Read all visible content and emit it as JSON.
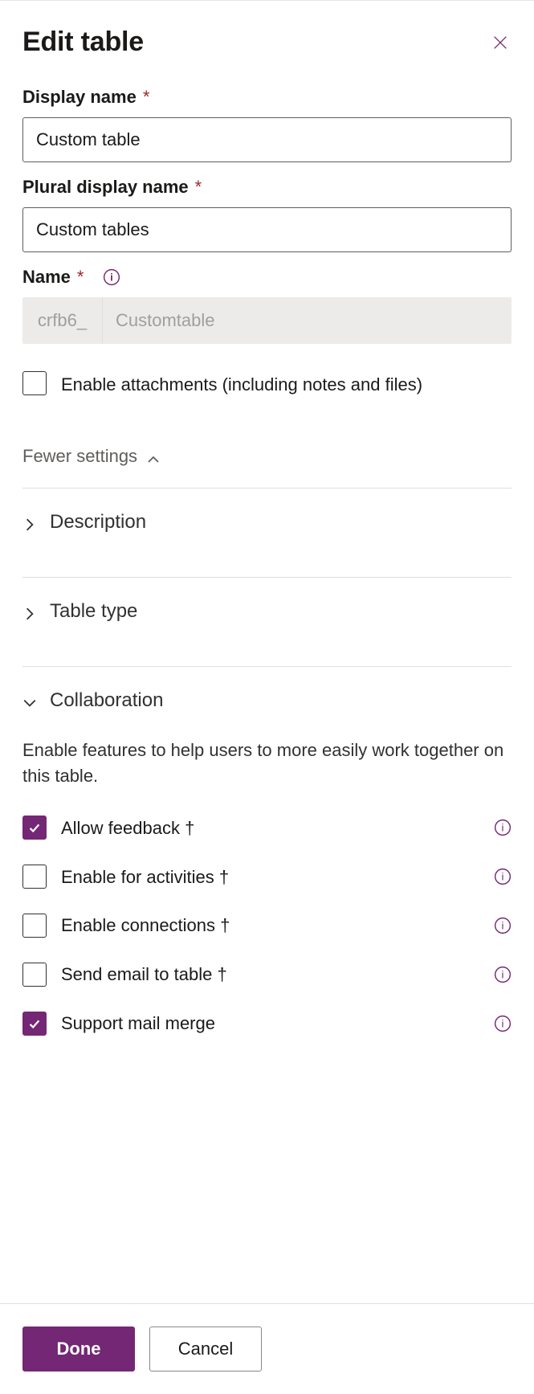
{
  "header": {
    "title": "Edit table"
  },
  "fields": {
    "display_name_label": "Display name",
    "display_name_value": "Custom table",
    "plural_label": "Plural display name",
    "plural_value": "Custom tables",
    "name_label": "Name",
    "name_prefix": "crfb6_",
    "name_value": "Customtable",
    "enable_attachments_label": "Enable attachments (including notes and files)"
  },
  "toggles": {
    "fewer_settings": "Fewer settings"
  },
  "sections": {
    "description": "Description",
    "table_type": "Table type",
    "collaboration": "Collaboration",
    "collaboration_desc": "Enable features to help users to more easily work together on this table."
  },
  "collab": {
    "allow_feedback": "Allow feedback †",
    "enable_activities": "Enable for activities †",
    "enable_connections": "Enable connections †",
    "send_email": "Send email to table †",
    "mail_merge": "Support mail merge"
  },
  "footer": {
    "done": "Done",
    "cancel": "Cancel"
  },
  "colors": {
    "primary": "#742774"
  }
}
